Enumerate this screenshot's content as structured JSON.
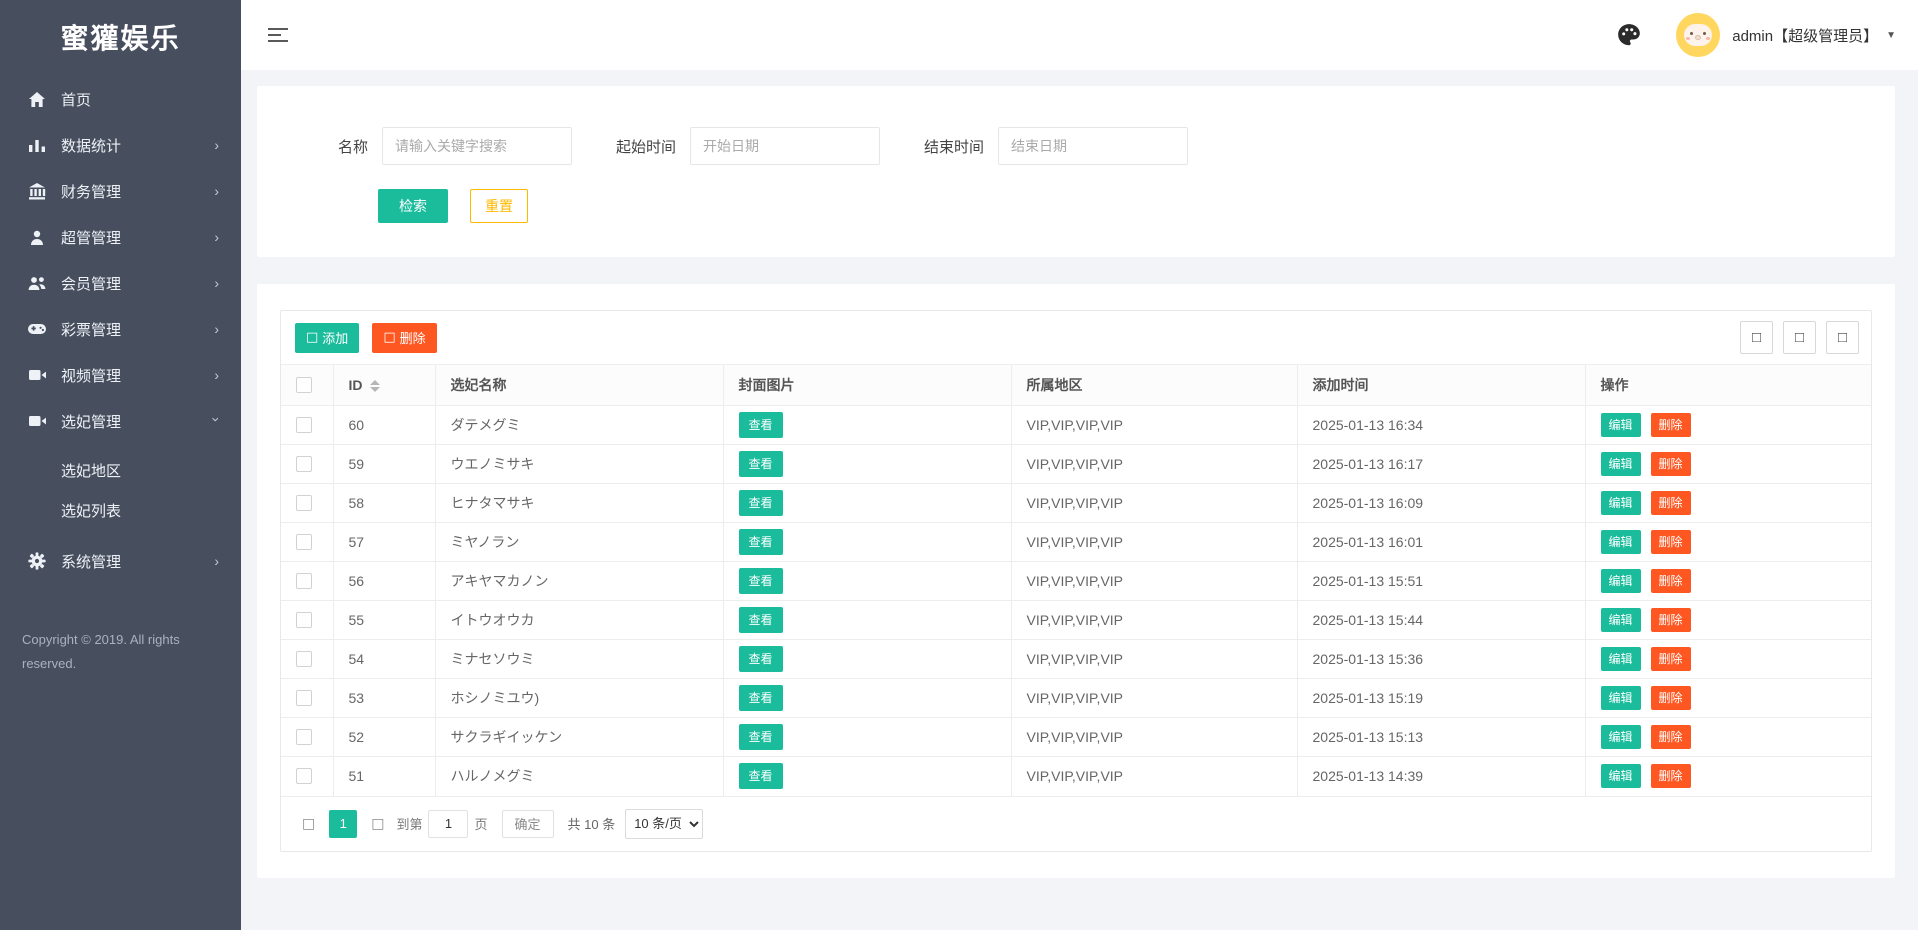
{
  "colors": {
    "green": "#1abc9c",
    "orange": "#ff5722",
    "yellow": "#ffb800",
    "sidebar_bg": "#474e5e"
  },
  "app": {
    "logo": "蜜獾娱乐",
    "user": "admin【超级管理员】"
  },
  "sidebar": {
    "items": [
      {
        "icon": "home-icon",
        "label": "首页",
        "arrow": ""
      },
      {
        "icon": "chart-icon",
        "label": "数据统计",
        "arrow": "right"
      },
      {
        "icon": "bank-icon",
        "label": "财务管理",
        "arrow": "right"
      },
      {
        "icon": "user-icon",
        "label": "超管管理",
        "arrow": "right"
      },
      {
        "icon": "users-icon",
        "label": "会员管理",
        "arrow": "right"
      },
      {
        "icon": "gamepad-icon",
        "label": "彩票管理",
        "arrow": "right"
      },
      {
        "icon": "video-icon",
        "label": "视频管理",
        "arrow": "right"
      },
      {
        "icon": "video-icon",
        "label": "选妃管理",
        "arrow": "down",
        "children": [
          "选妃地区",
          "选妃列表"
        ]
      },
      {
        "icon": "gear-icon",
        "label": "系统管理",
        "arrow": "right"
      }
    ],
    "copyright": "Copyright © 2019. All rights reserved."
  },
  "search": {
    "name_label": "名称",
    "name_placeholder": "请输入关键字搜索",
    "start_label": "起始时间",
    "start_placeholder": "开始日期",
    "end_label": "结束时间",
    "end_placeholder": "结束日期",
    "search_btn": "检索",
    "reset_btn": "重置"
  },
  "toolbar": {
    "add": "添加",
    "delete": "删除",
    "icon_placeholder": "□"
  },
  "table": {
    "columns": [
      "ID",
      "选妃名称",
      "封面图片",
      "所属地区",
      "添加时间",
      "操作"
    ],
    "view_btn": "查看",
    "edit_btn": "编辑",
    "del_btn": "删除",
    "rows": [
      {
        "id": "60",
        "name": "ダテメグミ",
        "region": "VIP,VIP,VIP,VIP",
        "time": "2025-01-13 16:34"
      },
      {
        "id": "59",
        "name": "ウエノミサキ",
        "region": "VIP,VIP,VIP,VIP",
        "time": "2025-01-13 16:17"
      },
      {
        "id": "58",
        "name": "ヒナタマサキ",
        "region": "VIP,VIP,VIP,VIP",
        "time": "2025-01-13 16:09"
      },
      {
        "id": "57",
        "name": "ミヤノラン",
        "region": "VIP,VIP,VIP,VIP",
        "time": "2025-01-13 16:01"
      },
      {
        "id": "56",
        "name": "アキヤマカノン",
        "region": "VIP,VIP,VIP,VIP",
        "time": "2025-01-13 15:51"
      },
      {
        "id": "55",
        "name": "イトウオウカ",
        "region": "VIP,VIP,VIP,VIP",
        "time": "2025-01-13 15:44"
      },
      {
        "id": "54",
        "name": "ミナセソウミ",
        "region": "VIP,VIP,VIP,VIP",
        "time": "2025-01-13 15:36"
      },
      {
        "id": "53",
        "name": "ホシノミユウ)",
        "region": "VIP,VIP,VIP,VIP",
        "time": "2025-01-13 15:19"
      },
      {
        "id": "52",
        "name": "サクラギイッケン",
        "region": "VIP,VIP,VIP,VIP",
        "time": "2025-01-13 15:13"
      },
      {
        "id": "51",
        "name": "ハルノメグミ",
        "region": "VIP,VIP,VIP,VIP",
        "time": "2025-01-13 14:39"
      }
    ]
  },
  "pagination": {
    "prev": "□",
    "next": "□",
    "current": "1",
    "goto_label": "到第",
    "page_input": "1",
    "page_label": "页",
    "confirm": "确定",
    "total": "共 10 条",
    "per_page": "10 条/页"
  }
}
